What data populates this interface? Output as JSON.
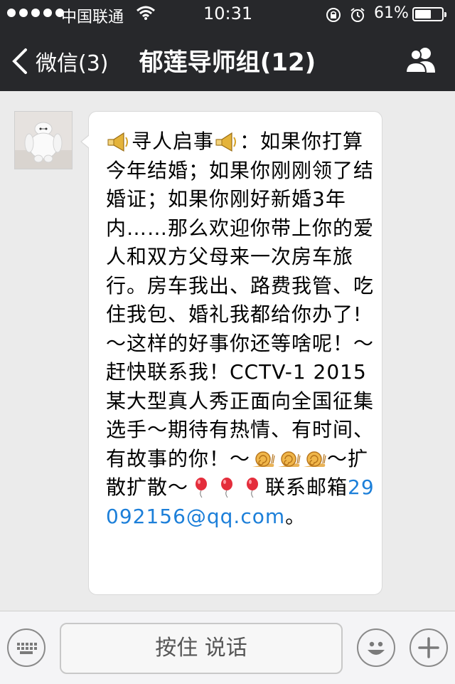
{
  "status_bar": {
    "carrier": "中国联通",
    "time": "10:31",
    "battery": "61%",
    "battery_level": 0.61
  },
  "nav": {
    "back_label": "微信(3)",
    "title": "郁莲导师组(12)"
  },
  "message": {
    "segments": [
      {
        "icon": "megaphone-icon"
      },
      {
        "text": "寻人启事"
      },
      {
        "icon": "megaphone-icon"
      },
      {
        "text": "：如果你打算今年结婚；如果你刚刚领了结婚证；如果你刚好新婚3年内……那么欢迎你带上你的爱人和双方父母来一次房车旅行。房车我出、路费我管、吃住我包、婚礼我都给你办了!～这样的好事你还等啥呢！～赶快联系我！CCTV-1 2015某大型真人秀正面向全国征集选手～期待有热情、有时间、有故事的你！～"
      },
      {
        "icon": "snail-icon"
      },
      {
        "icon": "snail-icon"
      },
      {
        "icon": "snail-icon"
      },
      {
        "text": "～扩散扩散～"
      },
      {
        "icon": "balloon-icon"
      },
      {
        "icon": "balloon-icon"
      },
      {
        "icon": "balloon-icon"
      },
      {
        "text": "联系邮箱"
      }
    ],
    "email": "29092156@qq.com",
    "tail": "。"
  },
  "toolbar": {
    "talk_label": "按住 说话"
  },
  "colors": {
    "bar_bg": "#27282b",
    "chat_bg": "#ebebeb",
    "link": "#1c7fd9"
  }
}
